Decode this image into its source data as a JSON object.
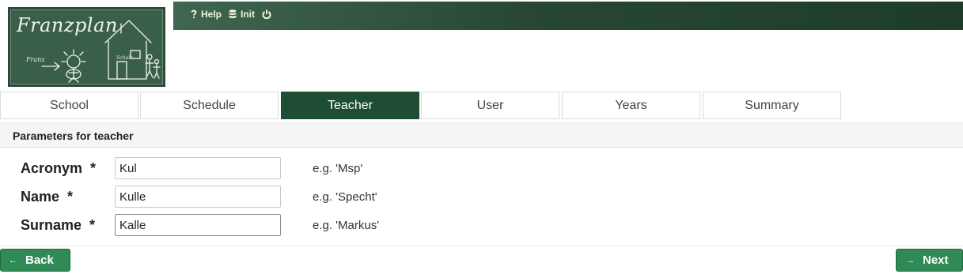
{
  "app": {
    "logo_title": "Franzplan",
    "logo_small_text": "Franz",
    "logo_tiny_text": "Schule"
  },
  "topbar": {
    "links": [
      {
        "label": "Help",
        "icon": "question-icon"
      },
      {
        "label": "Init",
        "icon": "database-icon"
      },
      {
        "label": "",
        "icon": "power-icon"
      }
    ]
  },
  "tabs": [
    {
      "label": "School",
      "active": false
    },
    {
      "label": "Schedule",
      "active": false
    },
    {
      "label": "Teacher",
      "active": true
    },
    {
      "label": "User",
      "active": false
    },
    {
      "label": "Years",
      "active": false
    },
    {
      "label": "Summary",
      "active": false
    }
  ],
  "section": {
    "title": "Parameters for teacher"
  },
  "form": {
    "fields": [
      {
        "label": "Acronym  *",
        "value": "Kul",
        "hint": "e.g. 'Msp'"
      },
      {
        "label": "Name  *",
        "value": "Kulle",
        "hint": "e.g. 'Specht'"
      },
      {
        "label": "Surname  *",
        "value": "Kalle",
        "hint": "e.g. 'Markus'"
      }
    ]
  },
  "footer": {
    "back_label": "Back",
    "next_label": "Next"
  },
  "colors": {
    "accent": "#1e4d33",
    "button": "#2f8a56",
    "topbar_text": "#f3f3d9"
  }
}
